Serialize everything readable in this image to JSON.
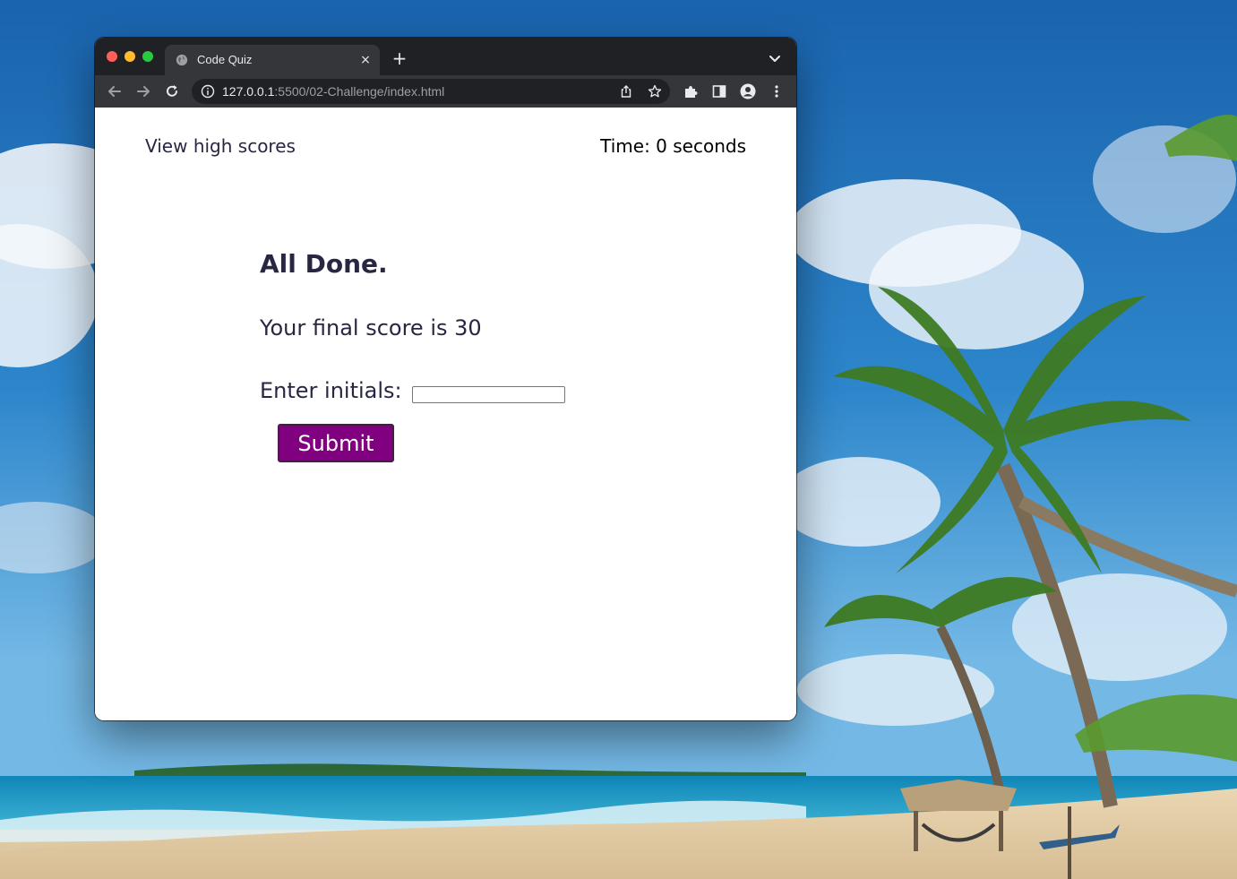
{
  "browser": {
    "tab_title": "Code Quiz",
    "new_tab_label": "+",
    "close_tab_label": "×",
    "url_host": "127.0.0.1",
    "url_rest": ":5500/02-Challenge/index.html"
  },
  "page": {
    "high_scores_link": "View high scores",
    "timer_text": "Time: 0 seconds",
    "done_title": "All Done.",
    "final_score_text": "Your final score is 30",
    "initials_label": "Enter initials:",
    "initials_value": "",
    "submit_label": "Submit"
  },
  "colors": {
    "submit_background": "#800080",
    "text_primary": "#282743",
    "tab_strip": "#202124",
    "toolbar": "#35363a"
  }
}
